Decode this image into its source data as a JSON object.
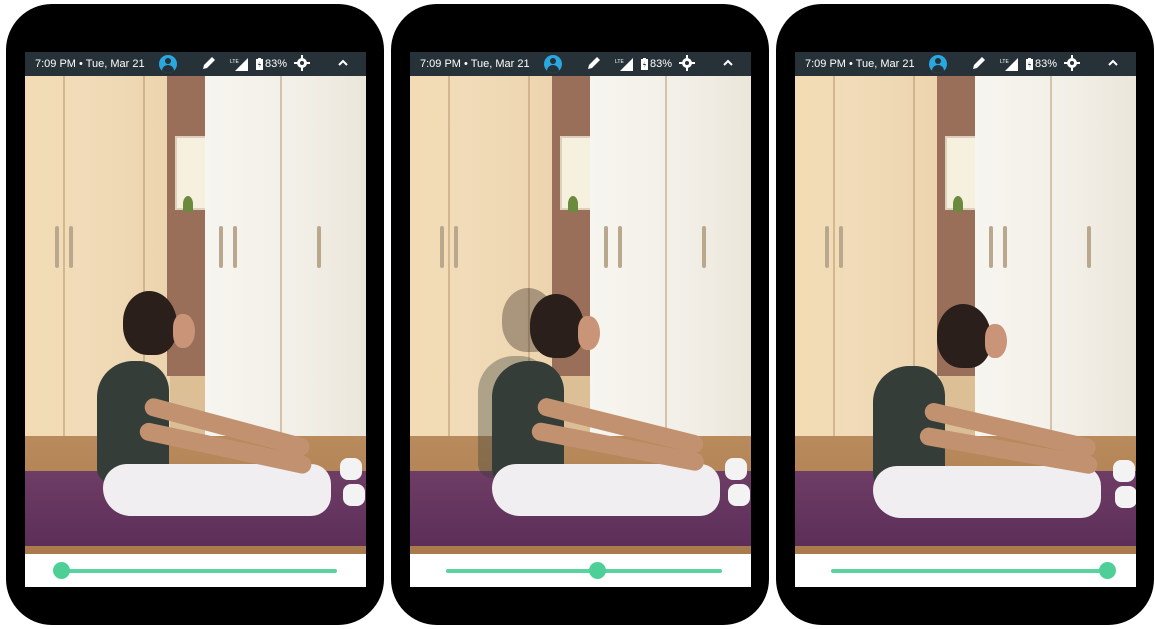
{
  "status_bar": {
    "time": "7:09 PM • Tue, Mar 21",
    "signal_label": "LTE",
    "battery": "83%",
    "icons": [
      "avatar-icon",
      "pencil-icon",
      "signal-icon",
      "battery-icon",
      "gear-icon",
      "chevron-up-icon"
    ]
  },
  "colors": {
    "status_bar_bg": "#263238",
    "accent": "#4fcf98",
    "avatar": "#29a8e0",
    "mat": "#5c2e58"
  },
  "phones": [
    {
      "slider_value": 0.0
    },
    {
      "slider_value": 0.55
    },
    {
      "slider_value": 1.0
    }
  ]
}
